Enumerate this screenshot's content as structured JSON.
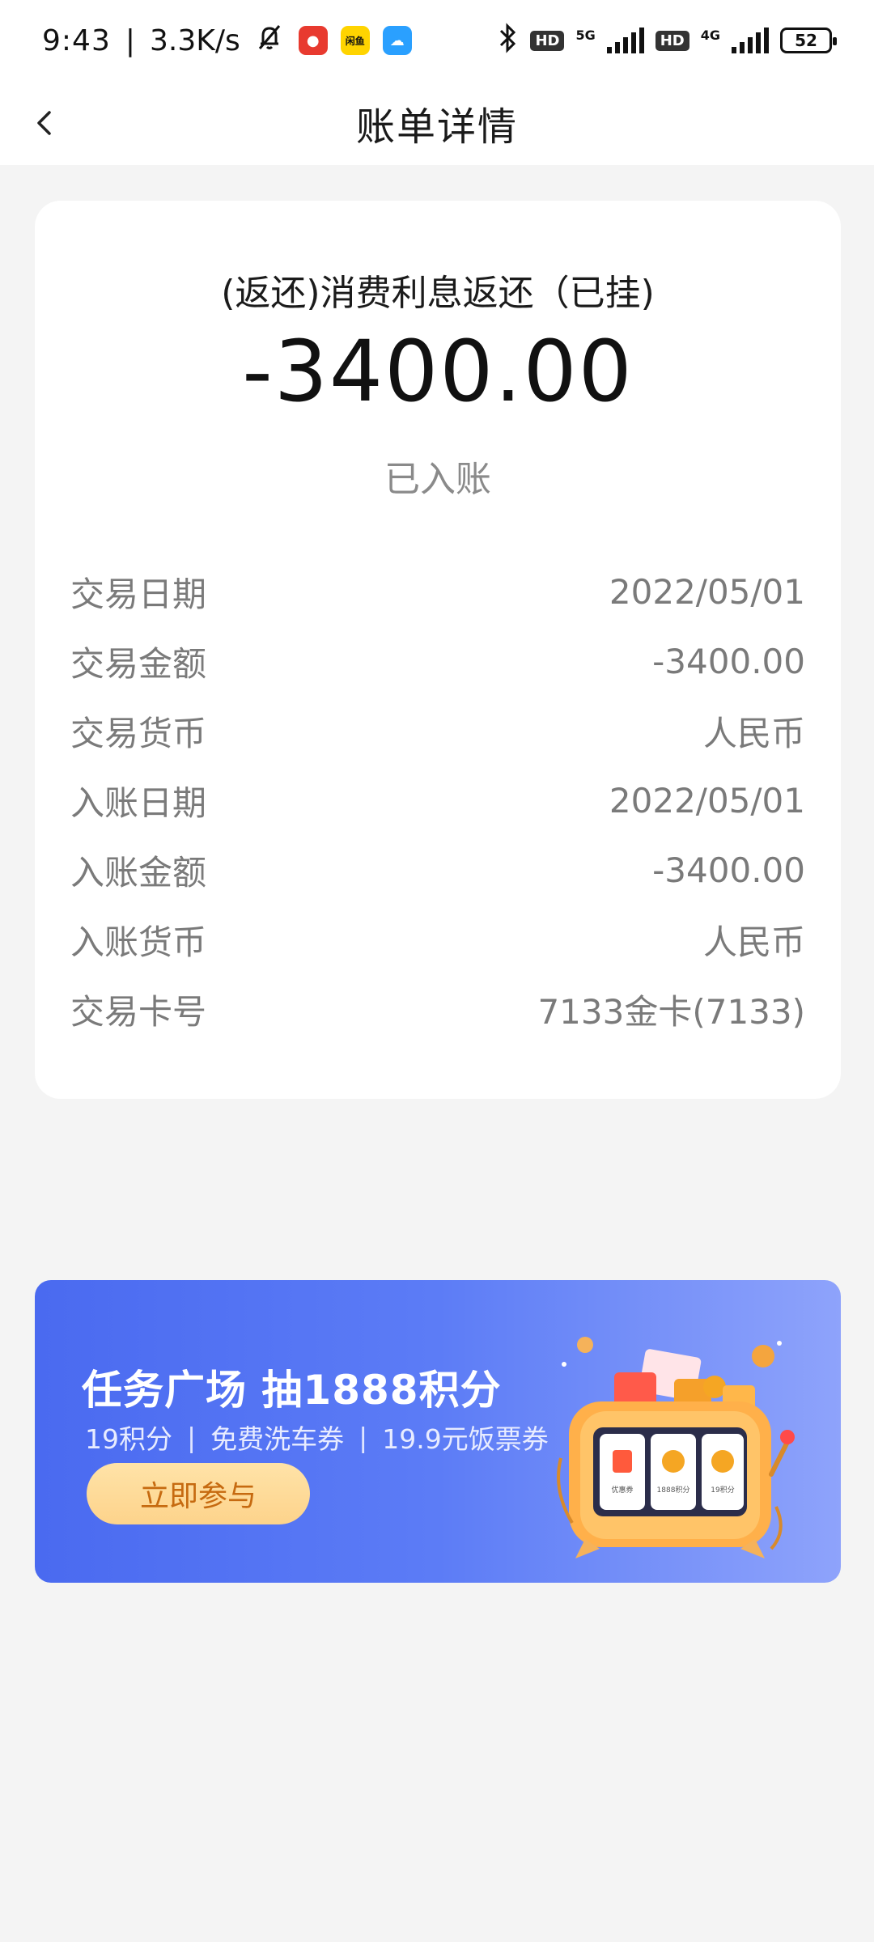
{
  "status_bar": {
    "time": "9:43",
    "separator": "|",
    "net_speed": "3.3K/s",
    "app_icon_2_text": "闲鱼",
    "hd_1": "HD",
    "net_1": "5G",
    "hd_2": "HD",
    "net_2": "4G",
    "battery": "52"
  },
  "header": {
    "title": "账单详情"
  },
  "transaction": {
    "title": "(返还)消费利息返还（已挂)",
    "amount": "-3400.00",
    "status": "已入账",
    "rows": [
      {
        "label": "交易日期",
        "value": "2022/05/01"
      },
      {
        "label": "交易金额",
        "value": "-3400.00"
      },
      {
        "label": "交易货币",
        "value": "人民币"
      },
      {
        "label": "入账日期",
        "value": "2022/05/01"
      },
      {
        "label": "入账金额",
        "value": "-3400.00"
      },
      {
        "label": "入账货币",
        "value": "人民币"
      },
      {
        "label": "交易卡号",
        "value": "7133金卡(7133)"
      }
    ]
  },
  "banner": {
    "title": "任务广场 抽1888积分",
    "sub_1": "19积分",
    "sub_2": "免费洗车券",
    "sub_3": "19.9元饭票券",
    "sub_sep": "|",
    "button_label": "立即参与",
    "reel_1": "优惠券",
    "reel_2": "1888积分",
    "reel_3": "19积分"
  },
  "colors": {
    "banner_start": "#4a6af0",
    "banner_end": "#8ea3fb",
    "button_text": "#c66a10"
  }
}
